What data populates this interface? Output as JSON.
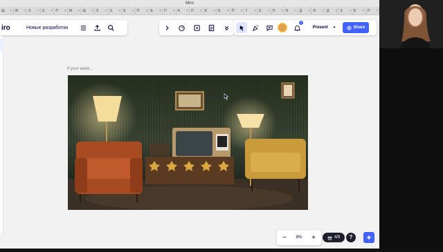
{
  "window": {
    "title": "Miro"
  },
  "tabs": [
    "Щ",
    "W",
    "S",
    "S",
    "П",
    "M",
    "Ш",
    "S",
    "S",
    "Б",
    "П",
    "Б",
    "П",
    "А",
    "П",
    "Б",
    "Б",
    "П",
    "Т",
    "S",
    "П",
    "Б",
    "Д",
    "Я",
    "Д",
    "S",
    "Б",
    "П"
  ],
  "toolbar": {
    "logo": "iro",
    "board_name": "Новые разработки",
    "present_label": "Present",
    "share_label": "Share",
    "notification_count": "1"
  },
  "frame": {
    "label": "If your week..."
  },
  "bottom": {
    "zoom": "8%",
    "page_indicator": "4/9",
    "help": "?"
  },
  "icons": {
    "menu": "hamburger-icon",
    "export": "upload-icon",
    "search": "search-icon",
    "expand": "chevron-right-icon",
    "timer": "timer-icon",
    "present_board": "board-icon",
    "notes": "notes-icon",
    "more": "chevrons-down-icon",
    "select": "cursor-icon",
    "reaction": "party-icon",
    "comments": "comment-icon",
    "bell": "bell-icon",
    "globe": "globe-icon",
    "gift": "gift-icon",
    "sparkle": "sparkle-icon"
  },
  "colors": {
    "accent": "#4262ff",
    "brand_text": "#050038"
  }
}
